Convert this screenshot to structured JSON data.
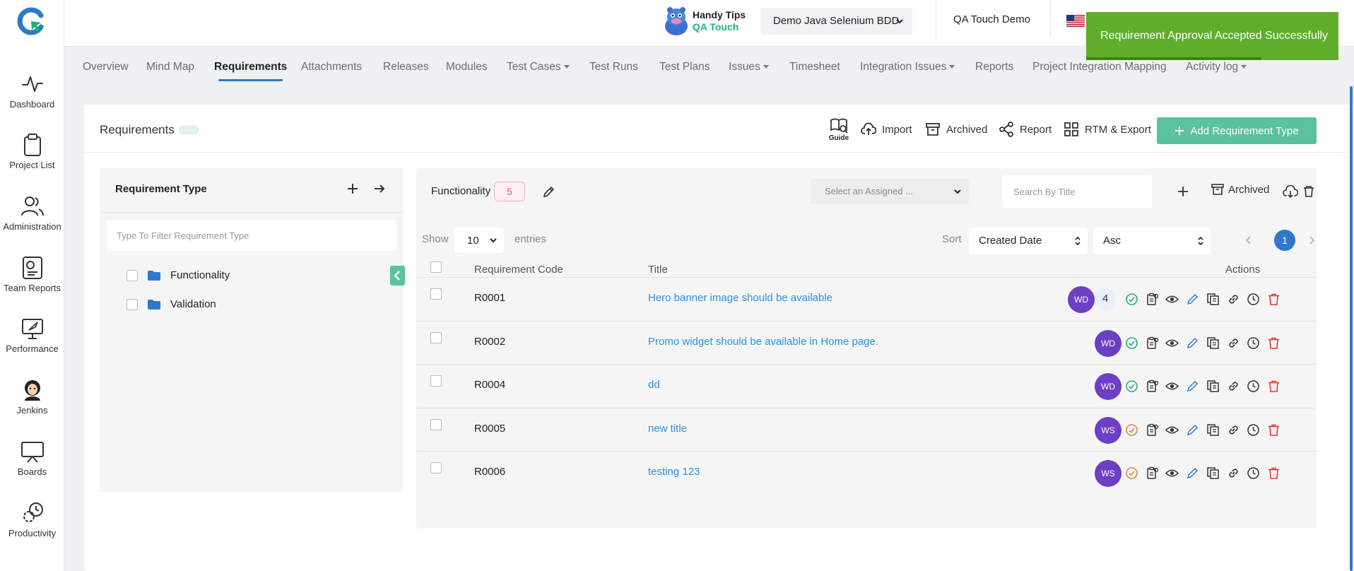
{
  "sidebar": {
    "items": [
      {
        "label": "Dashboard",
        "icon": "activity-icon"
      },
      {
        "label": "Project List",
        "icon": "clipboard-icon"
      },
      {
        "label": "Administration",
        "icon": "users-icon"
      },
      {
        "label": "Team Reports",
        "icon": "report-icon"
      },
      {
        "label": "Performance",
        "icon": "rocket-icon"
      },
      {
        "label": "Jenkins",
        "icon": "jenkins-icon"
      },
      {
        "label": "Boards",
        "icon": "board-icon"
      },
      {
        "label": "Productivity",
        "icon": "gear-clock-icon"
      }
    ]
  },
  "header": {
    "handy_tips": "Handy Tips",
    "handy_brand": "QA Touch",
    "project_name": "Demo Java Selenium BDD",
    "org_name": "QA Touch Demo"
  },
  "nav": {
    "tabs": [
      {
        "label": "Overview",
        "dropdown": false
      },
      {
        "label": "Mind Map",
        "dropdown": false
      },
      {
        "label": "Requirements",
        "dropdown": false
      },
      {
        "label": "Attachments",
        "dropdown": false
      },
      {
        "label": "Releases",
        "dropdown": false
      },
      {
        "label": "Modules",
        "dropdown": false
      },
      {
        "label": "Test Cases",
        "dropdown": true
      },
      {
        "label": "Test Runs",
        "dropdown": false
      },
      {
        "label": "Test Plans",
        "dropdown": false
      },
      {
        "label": "Issues",
        "dropdown": true
      },
      {
        "label": "Timesheet",
        "dropdown": false
      },
      {
        "label": "Integration Issues",
        "dropdown": true
      },
      {
        "label": "Reports",
        "dropdown": false
      },
      {
        "label": "Project Integration Mapping",
        "dropdown": false
      },
      {
        "label": "Activity log",
        "dropdown": true
      }
    ]
  },
  "page": {
    "title": "Requirements",
    "toolbar": {
      "guide": "Guide",
      "import": "Import",
      "archived": "Archived",
      "report": "Report",
      "rtm": "RTM & Export",
      "add": "Add Requirement Type"
    }
  },
  "left_panel": {
    "title": "Requirement Type",
    "filter_placeholder": "Type To Filter Requirement Type",
    "items": [
      "Functionality",
      "Validation"
    ]
  },
  "right_panel": {
    "type_name": "Functionality",
    "count": "5",
    "assign_placeholder": "Select an Assigned ...",
    "search_placeholder": "Search By Title",
    "archived": "Archived",
    "show": "Show",
    "entries_value": "10",
    "entries": "entries",
    "sort": "Sort",
    "sort_field": "Created Date",
    "sort_order": "Asc",
    "page": "1",
    "columns": {
      "code": "Requirement Code",
      "title": "Title",
      "actions": "Actions"
    },
    "rows": [
      {
        "code": "R0001",
        "title": "Hero banner image should be available",
        "assignee": "WD",
        "link_count": "4",
        "approval": "approved"
      },
      {
        "code": "R0002",
        "title": "Promo widget should be available in Home page.",
        "assignee": "WD",
        "link_count": "",
        "approval": "approved"
      },
      {
        "code": "R0004",
        "title": "dd",
        "assignee": "WD",
        "link_count": "",
        "approval": "approved"
      },
      {
        "code": "R0005",
        "title": "new title",
        "assignee": "WS",
        "link_count": "",
        "approval": "pending"
      },
      {
        "code": "R0006",
        "title": "testing 123",
        "assignee": "WS",
        "link_count": "",
        "approval": "pending"
      }
    ]
  },
  "toast": {
    "message": "Requirement Approval Accepted Successfully"
  },
  "colors": {
    "accent": "#2e79c8",
    "primary_green": "#5cc19e",
    "link": "#2e8fde",
    "avatar": "#6c3fc5",
    "toast": "#5eae2b",
    "approved": "#1bb37d",
    "pending": "#d98a4a",
    "delete": "#e53935"
  }
}
